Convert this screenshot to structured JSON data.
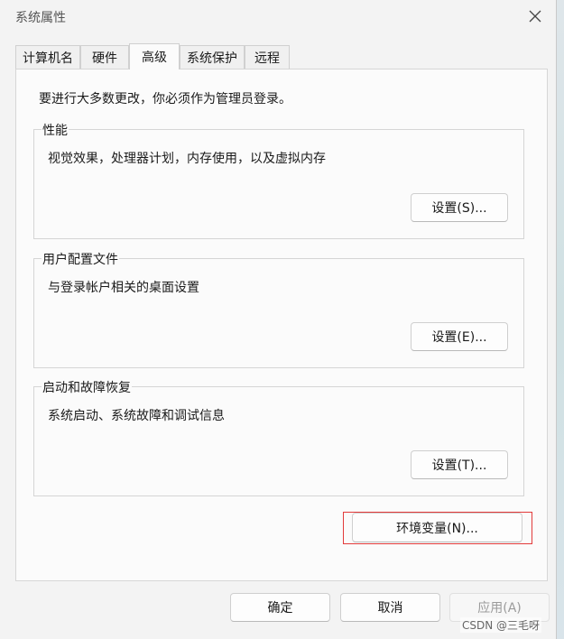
{
  "window": {
    "title": "系统属性"
  },
  "tabs": [
    {
      "label": "计算机名"
    },
    {
      "label": "硬件"
    },
    {
      "label": "高级"
    },
    {
      "label": "系统保护"
    },
    {
      "label": "远程"
    }
  ],
  "active_tab": "高级",
  "panel": {
    "notice": "要进行大多数更改，你必须作为管理员登录。",
    "groups": [
      {
        "title": "性能",
        "description": "视觉效果，处理器计划，内存使用，以及虚拟内存",
        "button": "设置(S)..."
      },
      {
        "title": "用户配置文件",
        "description": "与登录帐户相关的桌面设置",
        "button": "设置(E)..."
      },
      {
        "title": "启动和故障恢复",
        "description": "系统启动、系统故障和调试信息",
        "button": "设置(T)..."
      }
    ],
    "env_button": "环境变量(N)..."
  },
  "footer": {
    "ok": "确定",
    "cancel": "取消",
    "apply": "应用(A)"
  },
  "watermark": "CSDN @三毛呀",
  "colors": {
    "highlight": "#e23a3a",
    "window_bg": "#f3f3f3",
    "panel_bg": "#fbfbfb"
  }
}
